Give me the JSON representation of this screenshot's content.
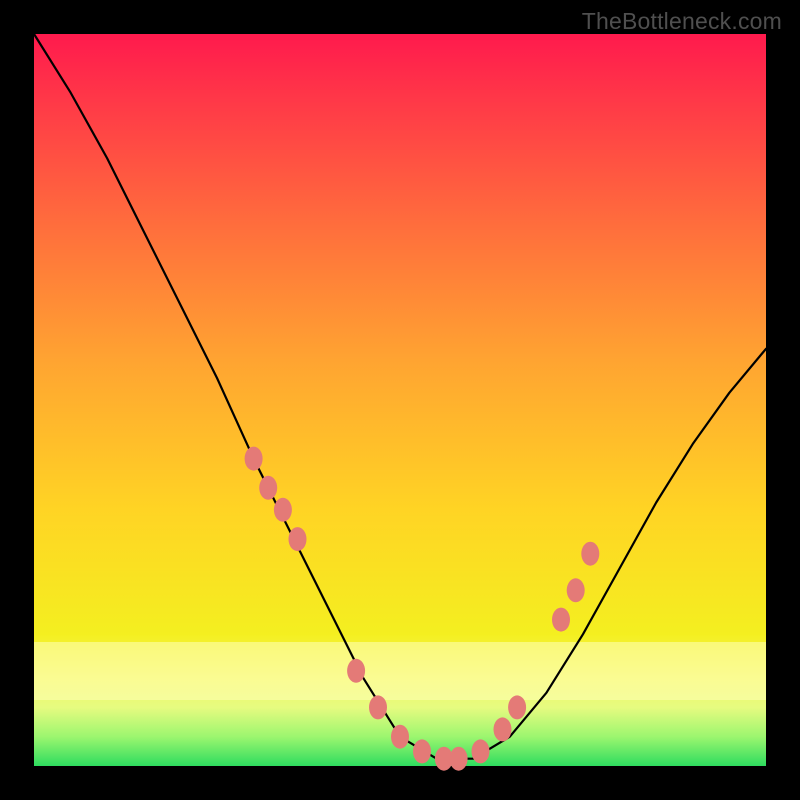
{
  "attribution": "TheBottleneck.com",
  "chart_data": {
    "type": "line",
    "title": "",
    "xlabel": "",
    "ylabel": "",
    "xlim": [
      0,
      100
    ],
    "ylim": [
      0,
      100
    ],
    "series": [
      {
        "name": "curve",
        "x": [
          0,
          5,
          10,
          15,
          20,
          25,
          30,
          35,
          40,
          45,
          50,
          55,
          60,
          65,
          70,
          75,
          80,
          85,
          90,
          95,
          100
        ],
        "values": [
          100,
          92,
          83,
          73,
          63,
          53,
          42,
          32,
          22,
          12,
          4,
          1,
          1,
          4,
          10,
          18,
          27,
          36,
          44,
          51,
          57
        ]
      }
    ],
    "markers": {
      "name": "highlighted-points",
      "color": "#e47a77",
      "x": [
        30,
        32,
        34,
        36,
        44,
        47,
        50,
        53,
        56,
        58,
        61,
        64,
        66,
        72,
        74,
        76
      ],
      "values": [
        42,
        38,
        35,
        31,
        13,
        8,
        4,
        2,
        1,
        1,
        2,
        5,
        8,
        20,
        24,
        29
      ]
    },
    "band": {
      "y0": 9,
      "y1": 17
    }
  }
}
